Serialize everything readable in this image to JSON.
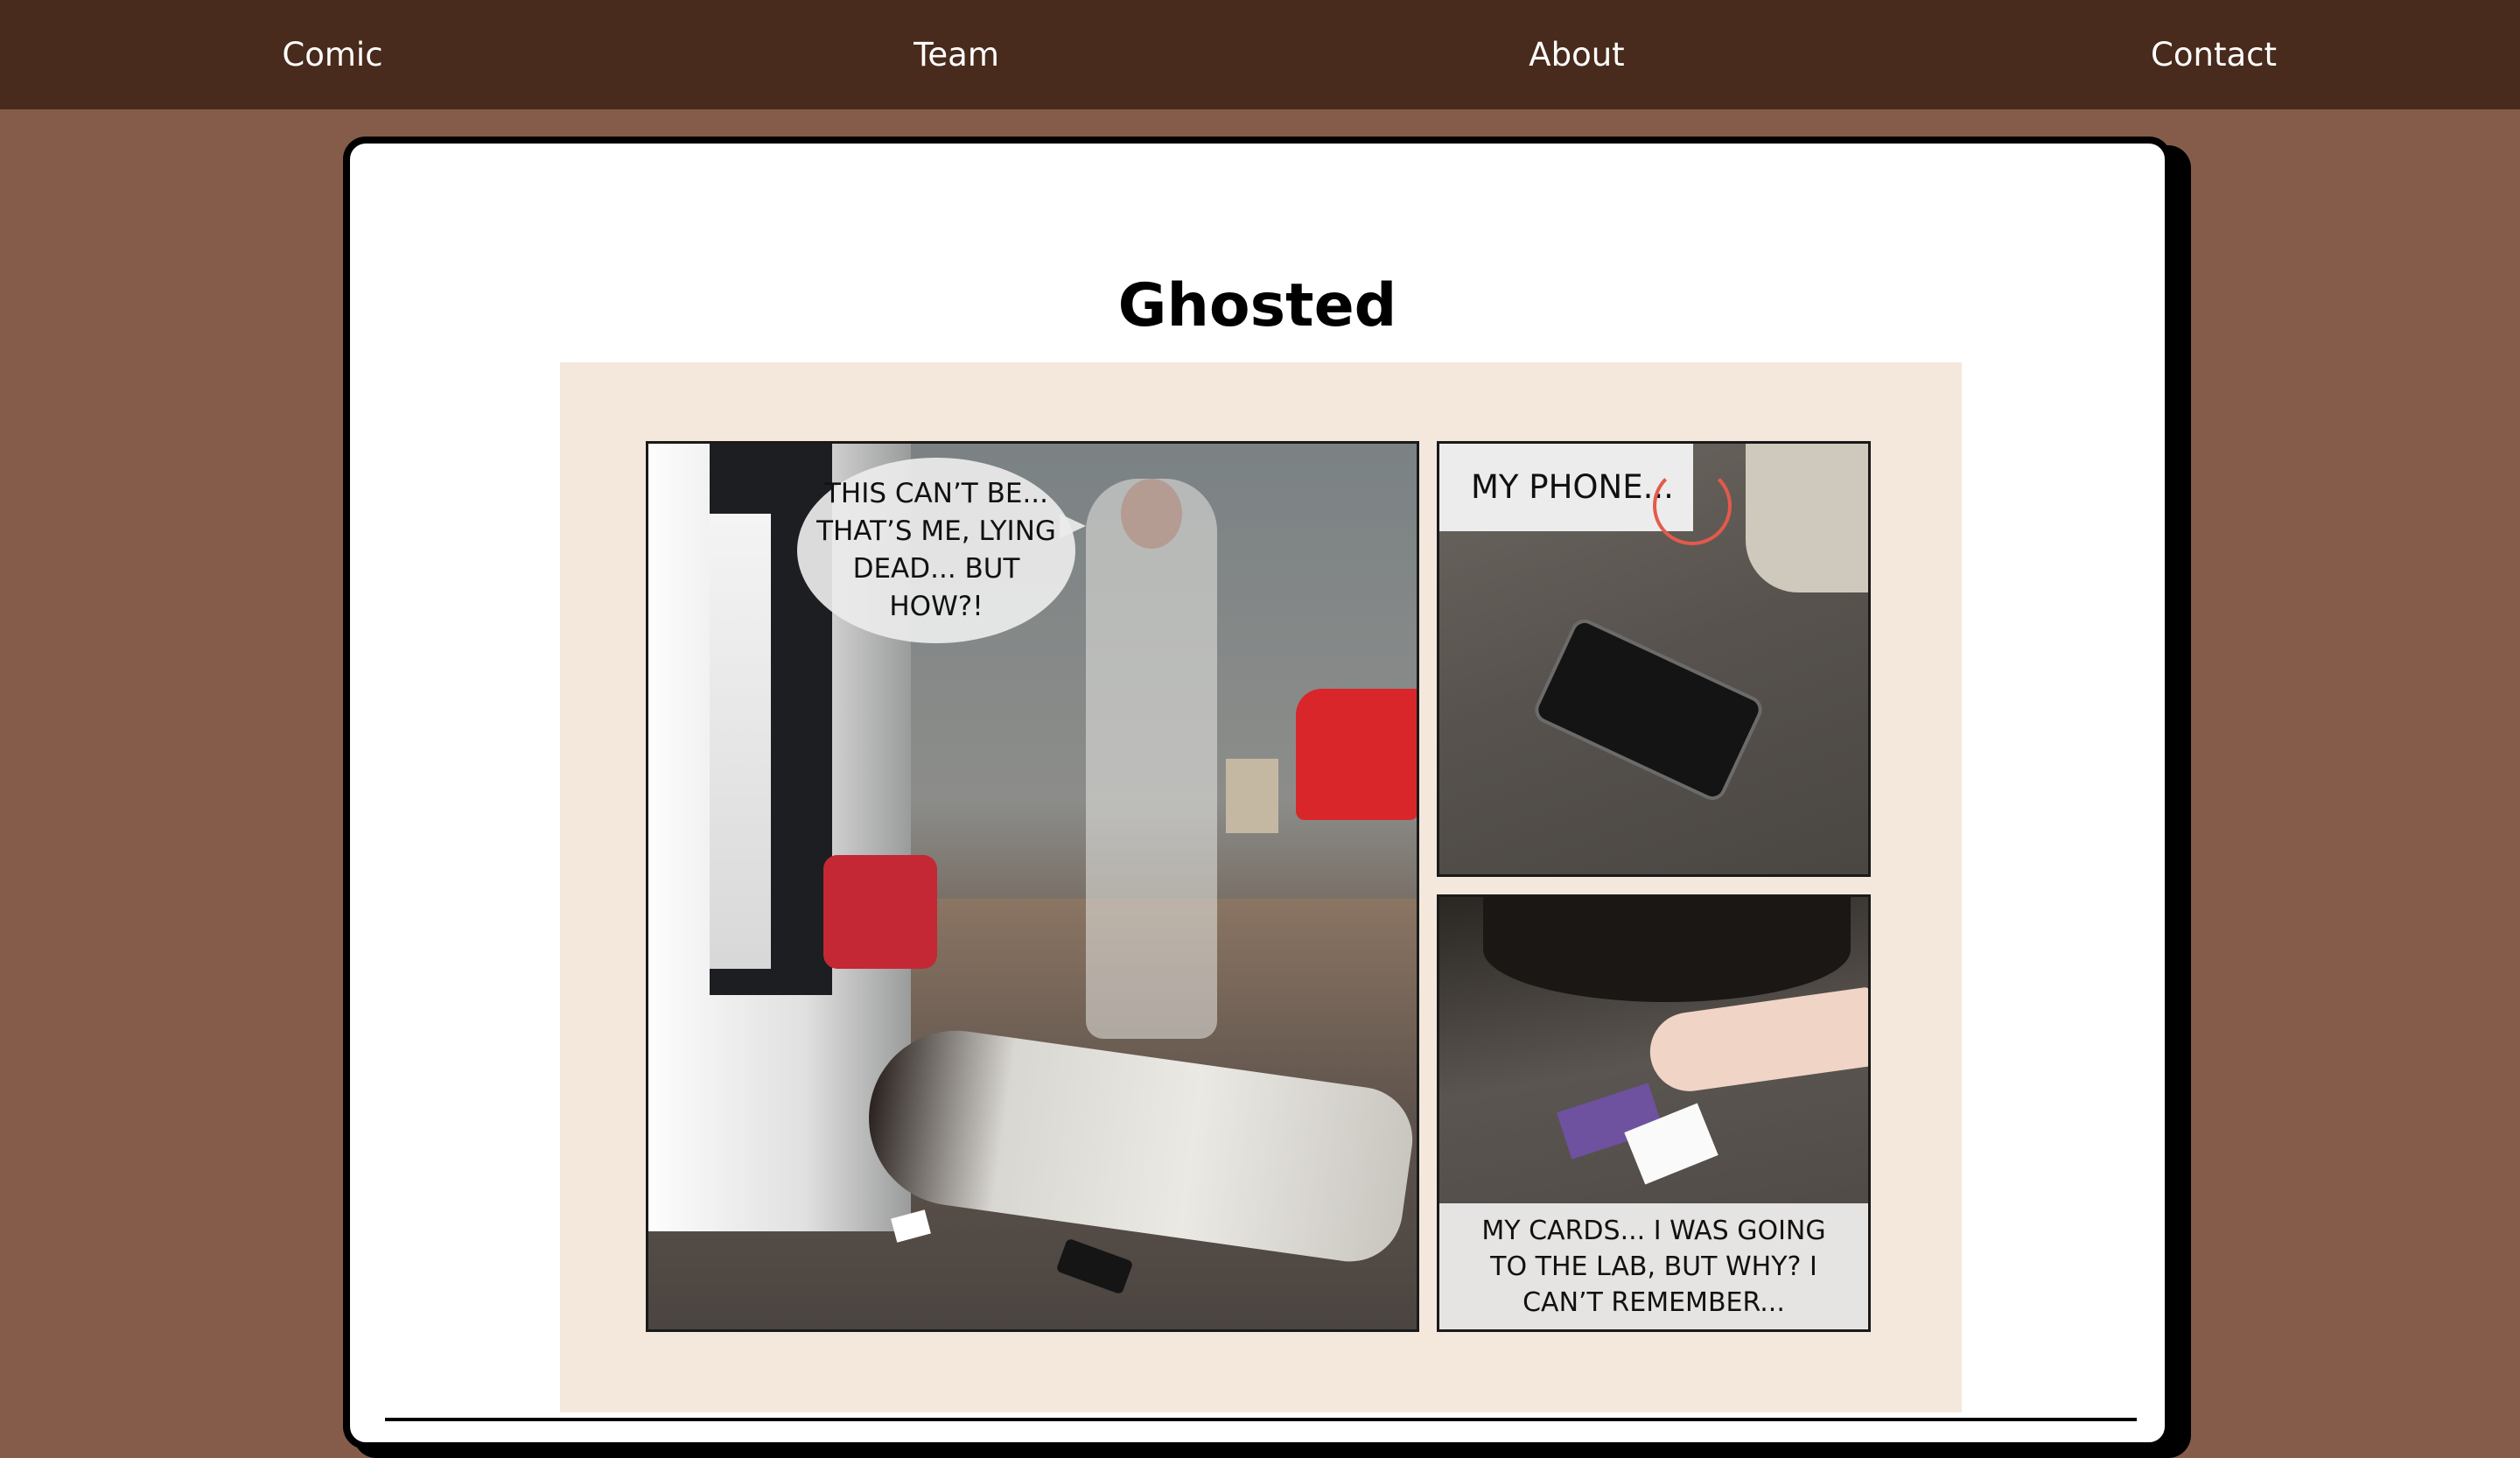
{
  "nav": {
    "items": [
      {
        "label": "Comic"
      },
      {
        "label": "Team"
      },
      {
        "label": "About"
      },
      {
        "label": "Contact"
      }
    ]
  },
  "comic": {
    "title": "Ghosted",
    "panels": {
      "main": {
        "speech": "THIS CAN’T BE... THAT’S ME, LYING DEAD... BUT HOW?!"
      },
      "phone": {
        "caption": "MY PHONE..."
      },
      "cards": {
        "caption": "MY CARDS... I WAS GOING TO THE LAB, BUT WHY? I CAN’T REMEMBER..."
      }
    }
  },
  "colors": {
    "nav_bg": "#482b1c",
    "page_bg": "#855c4a",
    "comic_bg": "#f4e8dc",
    "accent_ring": "#e45a4b"
  }
}
